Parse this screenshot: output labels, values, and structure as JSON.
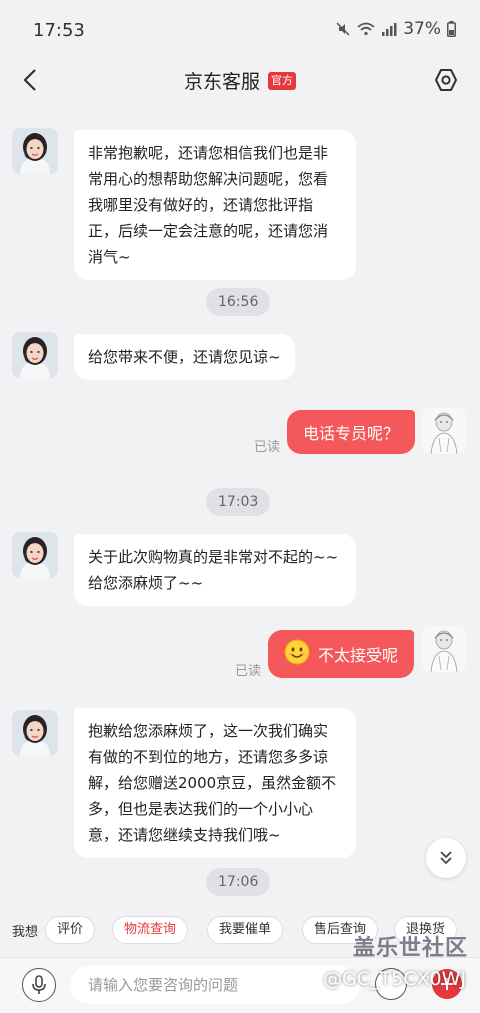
{
  "status_bar": {
    "time": "17:53",
    "battery": "37%"
  },
  "header": {
    "title": "京东客服",
    "badge": "官方"
  },
  "messages": {
    "m1": "非常抱歉呢，还请您相信我们也是非常用心的想帮助您解决问题呢，您看我哪里没有做好的，还请您批评指正，后续一定会注意的呢，还请您消消气~",
    "t1": "16:56",
    "m2": "给您带来不便，还请您见谅~",
    "u1": "电话专员呢？",
    "u1_read": "已读",
    "t2": "17:03",
    "m3": "关于此次购物真的是非常对不起的~~给您添麻烦了~~",
    "u2": "不太接受呢",
    "u2_read": "已读",
    "m4": "抱歉给您添麻烦了，这一次我们确实有做的不到位的地方，还请您多多谅解，给您赠送2000京豆，虽然金额不多，但也是表达我们的一个小小心意，还请您继续支持我们哦~",
    "t3": "17:06"
  },
  "quick_bar": {
    "label": "我想",
    "chips": [
      "评价",
      "物流查询",
      "我要催单",
      "售后查询",
      "退换货"
    ]
  },
  "input": {
    "placeholder": "请输入您要咨询的问题"
  },
  "watermark": {
    "site": "盖乐世社区",
    "user": "@GC_T5CX0WJ"
  },
  "colors": {
    "accent": "#e4393c",
    "user_bubble": "#f5585a",
    "background": "#f2f2f4"
  }
}
